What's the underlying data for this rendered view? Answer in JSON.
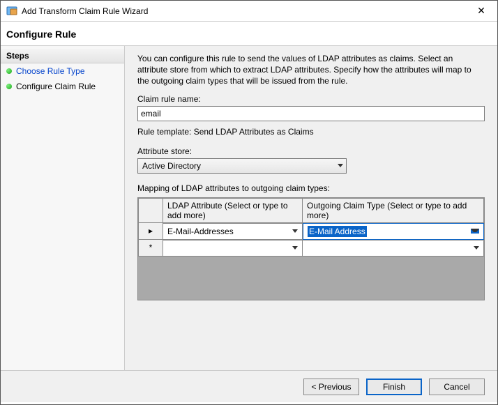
{
  "window": {
    "title": "Add Transform Claim Rule Wizard"
  },
  "header": {
    "subtitle": "Configure Rule"
  },
  "sidebar": {
    "header": "Steps",
    "items": [
      {
        "label": "Choose Rule Type",
        "is_link": true
      },
      {
        "label": "Configure Claim Rule",
        "is_link": false
      }
    ]
  },
  "main": {
    "description": "You can configure this rule to send the values of LDAP attributes as claims. Select an attribute store from which to extract LDAP attributes. Specify how the attributes will map to the outgoing claim types that will be issued from the rule.",
    "rule_name_label": "Claim rule name:",
    "rule_name_value": "email",
    "rule_template_label": "Rule template: Send LDAP Attributes as Claims",
    "attr_store_label": "Attribute store:",
    "attr_store_value": "Active Directory",
    "mapping_label": "Mapping of LDAP attributes to outgoing claim types:",
    "grid": {
      "headers": {
        "ldap": "LDAP Attribute (Select or type to add more)",
        "claim": "Outgoing Claim Type (Select or type to add more)"
      },
      "rows": [
        {
          "indicator": "▸",
          "ldap": "E-Mail-Addresses",
          "claim": "E-Mail Address",
          "selected": true
        },
        {
          "indicator": "*",
          "ldap": "",
          "claim": "",
          "selected": false
        }
      ]
    }
  },
  "footer": {
    "previous": "< Previous",
    "finish": "Finish",
    "cancel": "Cancel"
  }
}
